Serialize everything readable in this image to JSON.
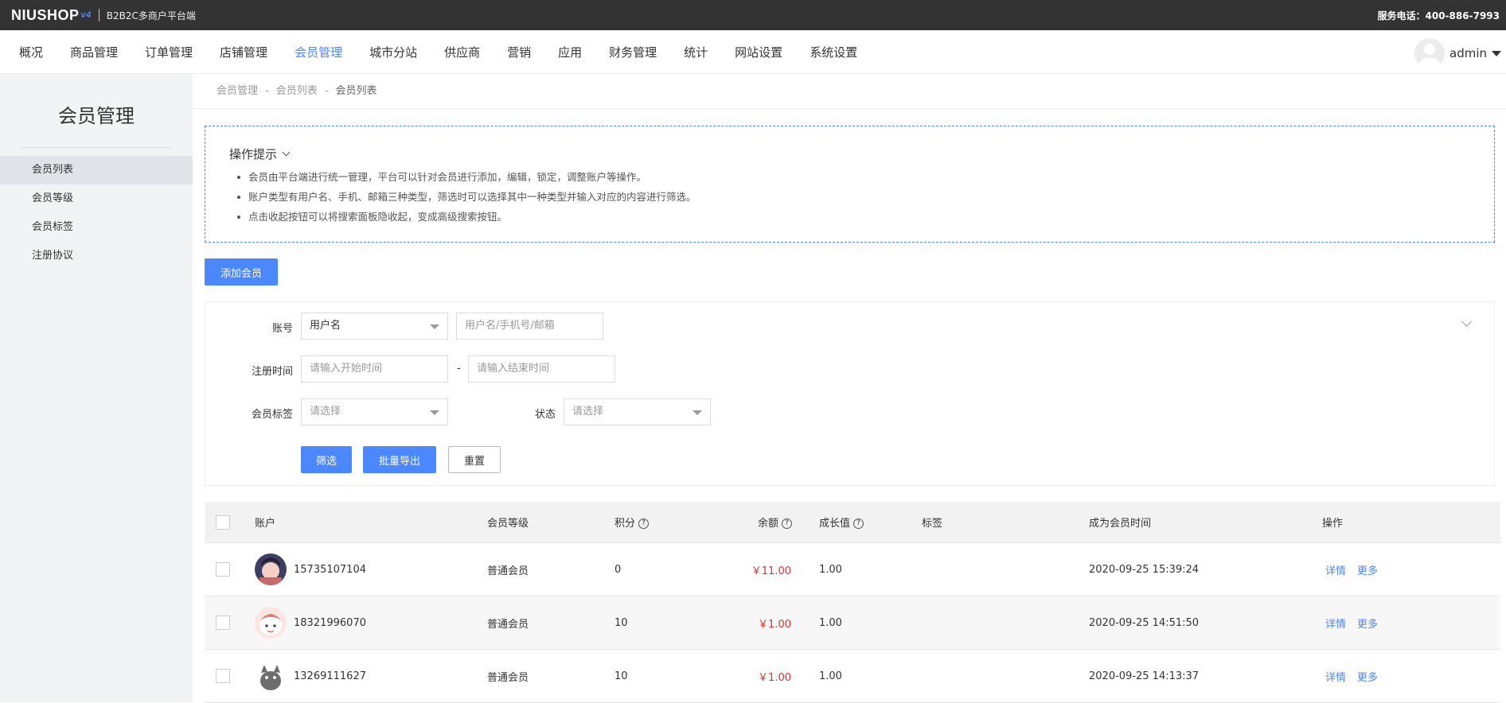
{
  "topbar": {
    "logo": "NIUSHOP",
    "logo_version": "v4",
    "platform": "B2B2C多商户平台端",
    "service": "服务电话：400-886-7993"
  },
  "nav": {
    "items": [
      "概况",
      "商品管理",
      "订单管理",
      "店铺管理",
      "会员管理",
      "城市分站",
      "供应商",
      "营销",
      "应用",
      "财务管理",
      "统计",
      "网站设置",
      "系统设置"
    ],
    "active": "会员管理",
    "user": "admin"
  },
  "sidebar": {
    "title": "会员管理",
    "items": [
      "会员列表",
      "会员等级",
      "会员标签",
      "注册协议"
    ]
  },
  "breadcrumb": [
    "会员管理",
    "会员列表",
    "会员列表"
  ],
  "breadcrumb_sep": "-",
  "tips": {
    "title": "操作提示",
    "items": [
      "会员由平台端进行统一管理，平台可以针对会员进行添加，编辑，锁定，调整账户等操作。",
      "账户类型有用户名、手机、邮箱三种类型，筛选时可以选择其中一种类型并输入对应的内容进行筛选。",
      "点击收起按钮可以将搜索面板隐收起，变成高级搜索按钮。"
    ]
  },
  "add_button": "添加会员",
  "filter": {
    "account_label": "账号",
    "account_type": "用户名",
    "account_placeholder": "用户名/手机号/邮箱",
    "regtime_label": "注册时间",
    "start_placeholder": "请输入开始时间",
    "range_sep": "-",
    "end_placeholder": "请输入结束时间",
    "tag_label": "会员标签",
    "tag_placeholder": "请选择",
    "status_label": "状态",
    "status_placeholder": "请选择",
    "btn_filter": "筛选",
    "btn_export": "批量导出",
    "btn_reset": "重置"
  },
  "table": {
    "headers": {
      "account": "账户",
      "level": "会员等级",
      "points": "积分",
      "balance": "余额",
      "growth": "成长值",
      "tag": "标签",
      "time": "成为会员时间",
      "ops": "操作"
    },
    "help_icon": "?",
    "rows": [
      {
        "account": "15735107104",
        "level": "普通会员",
        "points": "0",
        "balance": "￥11.00",
        "growth": "1.00",
        "tag": "",
        "time": "2020-09-25 15:39:24",
        "op1": "详情",
        "op2": "更多"
      },
      {
        "account": "18321996070",
        "level": "普通会员",
        "points": "10",
        "balance": "￥1.00",
        "growth": "1.00",
        "tag": "",
        "time": "2020-09-25 14:51:50",
        "op1": "详情",
        "op2": "更多"
      },
      {
        "account": "13269111627",
        "level": "普通会员",
        "points": "10",
        "balance": "￥1.00",
        "growth": "1.00",
        "tag": "",
        "time": "2020-09-25 14:13:37",
        "op1": "详情",
        "op2": "更多"
      }
    ]
  },
  "colors": {
    "accent": "#4b87ff",
    "topbar": "#333333",
    "money": "#e03030",
    "sidebar_bg": "#f2f3f5"
  }
}
